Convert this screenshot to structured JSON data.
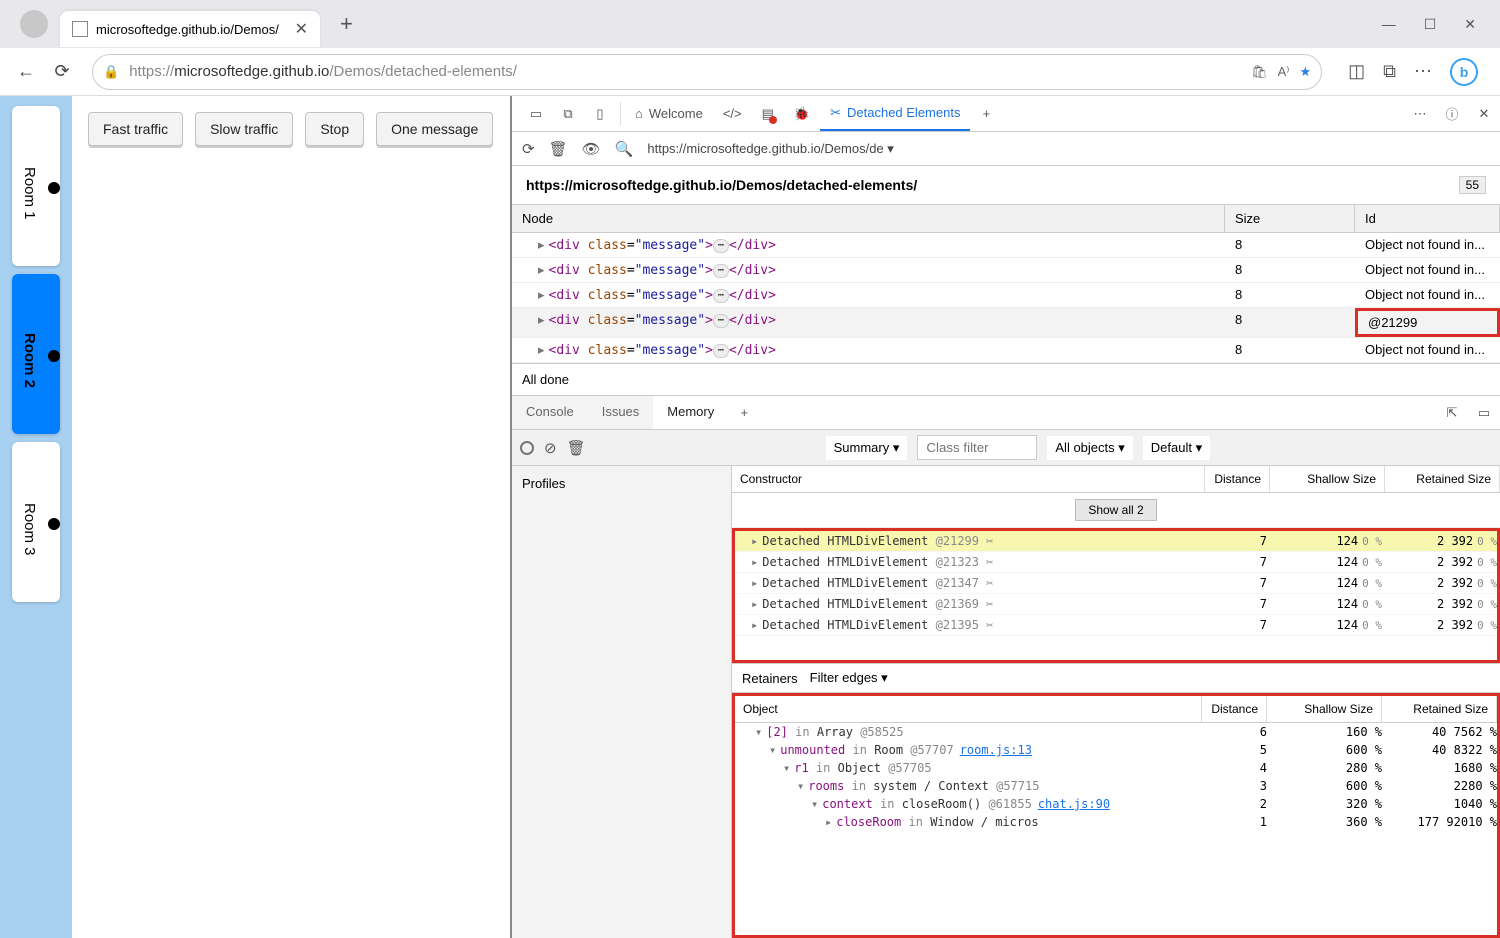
{
  "browser": {
    "tab_title": "microsoftedge.github.io/Demos/",
    "url_prefix": "https://",
    "url_host": "microsoftedge.github.io",
    "url_path": "/Demos/detached-elements/",
    "win_min": "—",
    "win_max": "☐",
    "win_close": "✕"
  },
  "page": {
    "buttons": [
      "Fast traffic",
      "Slow traffic",
      "Stop",
      "One message"
    ],
    "rooms": [
      "Room 1",
      "Room 2",
      "Room 3"
    ],
    "active_room": 1
  },
  "devtools": {
    "tabs": {
      "welcome": "Welcome",
      "detached": "Detached Elements"
    },
    "more": "⋯",
    "help": "?",
    "close": "✕",
    "frame_url": "https://microsoftedge.github.io/Demos/de",
    "header_url": "https://microsoftedge.github.io/Demos/detached-elements/",
    "count": "55",
    "columns": {
      "node": "Node",
      "size": "Size",
      "id": "Id"
    },
    "rows": [
      {
        "size": "8",
        "id": "Object not found in...",
        "sel": false,
        "boxed": false
      },
      {
        "size": "8",
        "id": "Object not found in...",
        "sel": false,
        "boxed": false
      },
      {
        "size": "8",
        "id": "Object not found in...",
        "sel": false,
        "boxed": false
      },
      {
        "size": "8",
        "id": "@21299",
        "sel": true,
        "boxed": true
      },
      {
        "size": "8",
        "id": "Object not found in...",
        "sel": false,
        "boxed": false
      }
    ],
    "status": "All done"
  },
  "drawer": {
    "tabs": [
      "Console",
      "Issues",
      "Memory"
    ],
    "active": 2,
    "summary": "Summary",
    "filter_placeholder": "Class filter",
    "all_objects": "All objects",
    "default": "Default",
    "profiles": "Profiles",
    "con_head": {
      "con": "Constructor",
      "dist": "Distance",
      "sh": "Shallow Size",
      "ret": "Retained Size"
    },
    "showall": "Show all 2",
    "con_rows": [
      {
        "label": "Detached HTMLDivElement",
        "at": "@21299",
        "dist": "7",
        "sh": "124",
        "shp": "0 %",
        "ret": "2 392",
        "retp": "0 %",
        "hl": true
      },
      {
        "label": "Detached HTMLDivElement",
        "at": "@21323",
        "dist": "7",
        "sh": "124",
        "shp": "0 %",
        "ret": "2 392",
        "retp": "0 %",
        "hl": false
      },
      {
        "label": "Detached HTMLDivElement",
        "at": "@21347",
        "dist": "7",
        "sh": "124",
        "shp": "0 %",
        "ret": "2 392",
        "retp": "0 %",
        "hl": false
      },
      {
        "label": "Detached HTMLDivElement",
        "at": "@21369",
        "dist": "7",
        "sh": "124",
        "shp": "0 %",
        "ret": "2 392",
        "retp": "0 %",
        "hl": false
      },
      {
        "label": "Detached HTMLDivElement",
        "at": "@21395",
        "dist": "7",
        "sh": "124",
        "shp": "0 %",
        "ret": "2 392",
        "retp": "0 %",
        "hl": false
      }
    ],
    "retainers": "Retainers",
    "filter_edges": "Filter edges",
    "ret_head": {
      "obj": "Object",
      "dist": "Distance",
      "sh": "Shallow Size",
      "ret": "Retained Size"
    },
    "ret_rows": [
      {
        "ind": 1,
        "tri": "▾",
        "prop": "[2]",
        "in": "in",
        "obj": "Array",
        "at": "@58525",
        "lnk": "",
        "dist": "6",
        "sh": "16",
        "shp": "0 %",
        "ret": "40 756",
        "retp": "2 %"
      },
      {
        "ind": 2,
        "tri": "▾",
        "prop": "unmounted",
        "in": "in",
        "obj": "Room",
        "at": "@57707",
        "lnk": "room.js:13",
        "dist": "5",
        "sh": "60",
        "shp": "0 %",
        "ret": "40 832",
        "retp": "2 %"
      },
      {
        "ind": 3,
        "tri": "▾",
        "prop": "r1",
        "in": "in",
        "obj": "Object",
        "at": "@57705",
        "lnk": "",
        "dist": "4",
        "sh": "28",
        "shp": "0 %",
        "ret": "168",
        "retp": "0 %"
      },
      {
        "ind": 4,
        "tri": "▾",
        "prop": "rooms",
        "in": "in",
        "obj": "system / Context",
        "at": "@57715",
        "lnk": "",
        "dist": "3",
        "sh": "60",
        "shp": "0 %",
        "ret": "228",
        "retp": "0 %"
      },
      {
        "ind": 5,
        "tri": "▾",
        "prop": "context",
        "in": "in",
        "obj": "closeRoom()",
        "at": "@61855",
        "lnk": "chat.js:90",
        "dist": "2",
        "sh": "32",
        "shp": "0 %",
        "ret": "104",
        "retp": "0 %"
      },
      {
        "ind": 6,
        "tri": "▸",
        "prop": "closeRoom",
        "in": "in",
        "obj": "Window / micros",
        "at": "",
        "lnk": "",
        "dist": "1",
        "sh": "36",
        "shp": "0 %",
        "ret": "177 920",
        "retp": "10 %"
      }
    ]
  }
}
